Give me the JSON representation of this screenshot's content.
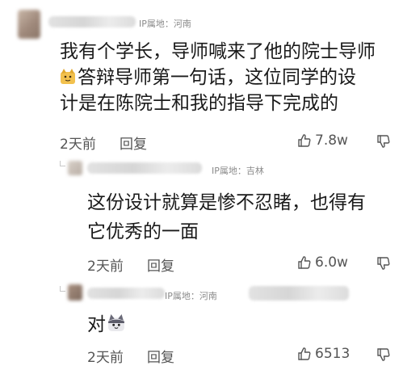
{
  "comments": [
    {
      "ip_label": "IP属地：河南",
      "lines": [
        "我有个学长，导师喊来了他的院士导师",
        "答辩导师第一句话，这位同学的设",
        "计是在陈院士和我的指导下完成的"
      ],
      "time": "2天前",
      "reply": "回复",
      "likes": "7.8w",
      "emoji": "cat-emoji"
    },
    {
      "ip_label": "IP属地：吉林",
      "lines": [
        "这份设计就算是惨不忍睹，也得有",
        "它优秀的一面"
      ],
      "time": "2天前",
      "reply": "回复",
      "likes": "6.0w"
    },
    {
      "ip_label": "IP属地：河南",
      "lines": [
        "对"
      ],
      "time": "2天前",
      "reply": "回复",
      "likes": "6513",
      "emoji": "cat-emoji"
    }
  ],
  "colors": {
    "text": "#1a1a1a",
    "meta": "#555555",
    "ip": "#8a8a8a"
  }
}
